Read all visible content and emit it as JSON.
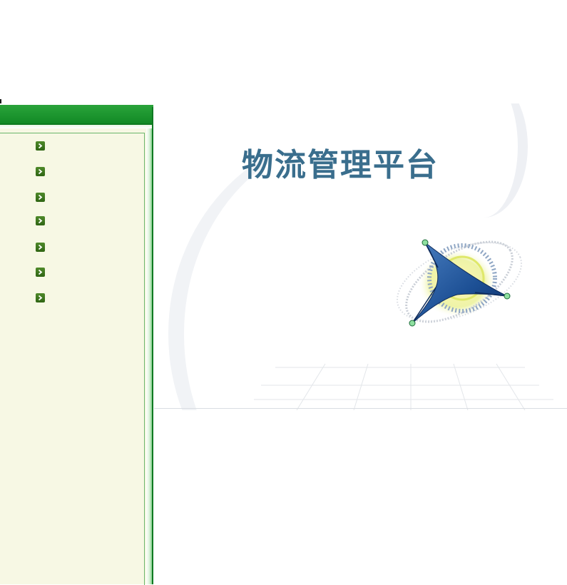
{
  "main": {
    "title": "物流管理平台"
  },
  "nav": {
    "items": [
      {
        "icon": "chevron-right-icon",
        "label": ""
      },
      {
        "icon": "chevron-right-icon",
        "label": ""
      },
      {
        "icon": "chevron-right-icon",
        "label": ""
      },
      {
        "icon": "chevron-right-icon",
        "label": ""
      },
      {
        "icon": "chevron-right-icon",
        "label": ""
      },
      {
        "icon": "chevron-right-icon",
        "label": ""
      },
      {
        "icon": "chevron-right-icon",
        "label": ""
      }
    ]
  },
  "colors": {
    "header_green": "#128a26",
    "panel_bg": "#f7f8e4",
    "title_blue": "#3a6e8d",
    "chevron_green": "#2f6513"
  }
}
